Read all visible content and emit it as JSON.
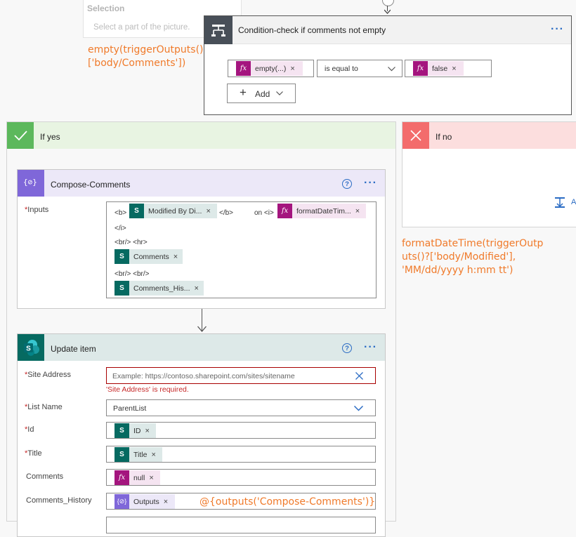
{
  "selection": {
    "title": "Selection",
    "hint": "Select a part of the picture."
  },
  "annotations": {
    "empty_expr": "empty(triggerOutputs()?\n['body/Comments'])",
    "format_expr": "formatDateTime(triggerOutp\nuts()?['body/Modified'],\n'MM/dd/yyyy h:mm tt')",
    "outputs_expr": "@{outputs('Compose-Comments')}"
  },
  "condition": {
    "title": "Condition-check if comments not empty",
    "left_token": "empty(...)",
    "operator": "is equal to",
    "right_token": "false",
    "add_label": "Add"
  },
  "branches": {
    "yes_label": "If yes",
    "no_label": "If no",
    "no_add_partial": "A"
  },
  "compose": {
    "title": "Compose-Comments",
    "inputs_label": "Inputs",
    "raw_b_open": "<b>",
    "token_modified_by": "Modified By Di...",
    "raw_b_close": "</b>",
    "raw_on_i": "on <i>",
    "token_format": "formatDateTim...",
    "raw_i_close": "</i>",
    "raw_br_hr": "<br/> <hr>",
    "token_comments": "Comments",
    "raw_br_br": "<br/> <br/>",
    "token_comments_history": "Comments_His..."
  },
  "update": {
    "title": "Update item",
    "site_label": "Site Address",
    "site_placeholder": "Example: https://contoso.sharepoint.com/sites/sitename",
    "site_error": "'Site Address' is required.",
    "list_label": "List Name",
    "list_value": "ParentList",
    "id_label": "Id",
    "id_token": "ID",
    "title_label": "Title",
    "title_token": "Title",
    "comments_label": "Comments",
    "comments_token": "null",
    "history_label": "Comments_History",
    "history_token": "Outputs"
  },
  "glyphs": {
    "close": "×",
    "more": "···",
    "help": "?",
    "fx": "fx",
    "sp": "S",
    "compose": "{⊘}",
    "required": "*"
  },
  "colors": {
    "accent": "#2b6cc4",
    "condition_icon": "#484f58",
    "yes_green": "#5cb85c",
    "no_red": "#f36c6c",
    "expression": "#a4157e",
    "sharepoint": "#066a61",
    "compose": "#7f67d9",
    "annotation": "#f07a2a",
    "error": "#c62828"
  }
}
